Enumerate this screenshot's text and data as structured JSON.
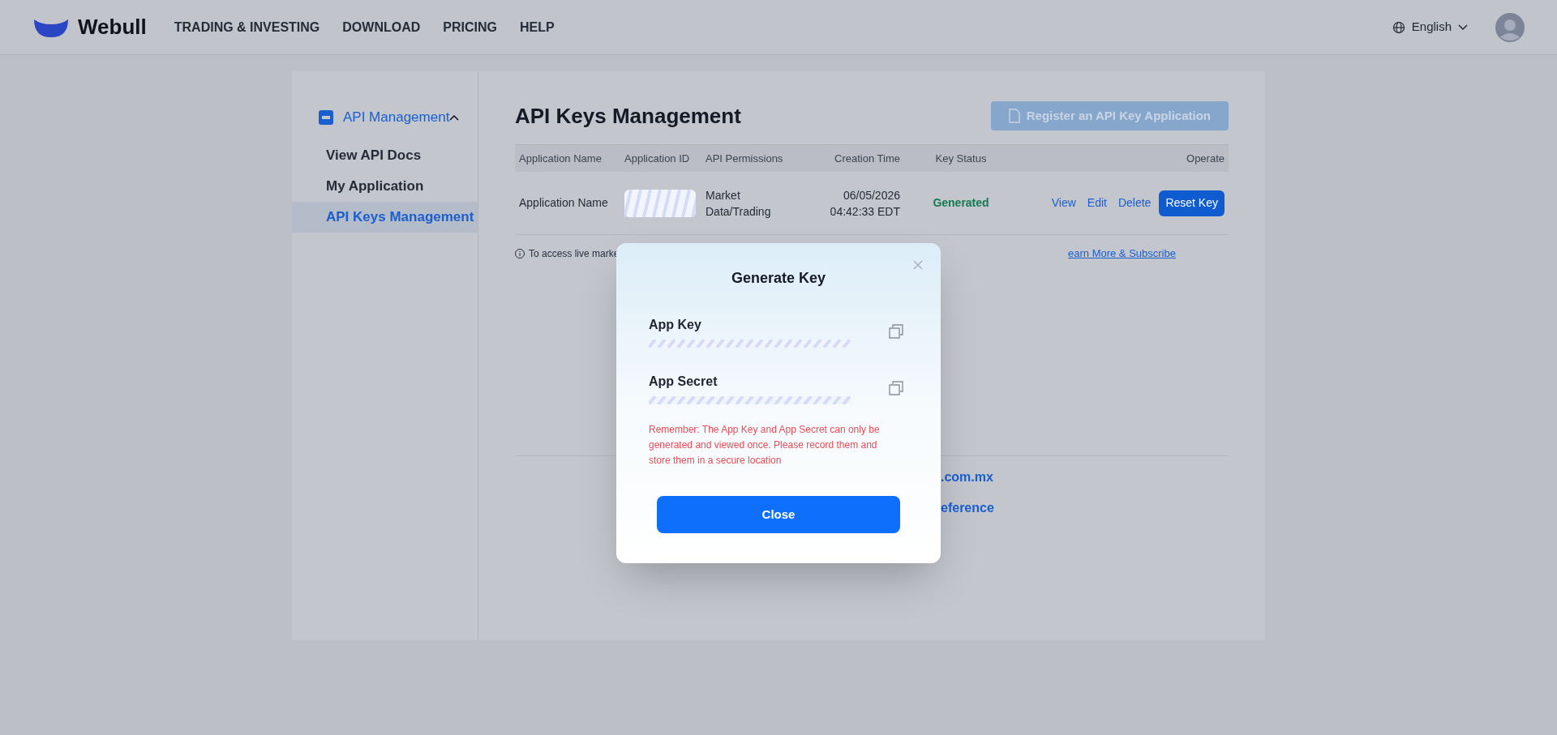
{
  "header": {
    "logo_text": "Webull",
    "nav": [
      "TRADING & INVESTING",
      "DOWNLOAD",
      "PRICING",
      "HELP"
    ],
    "language": "English"
  },
  "sidebar": {
    "group": {
      "label": "API Management",
      "expanded": true
    },
    "items": [
      {
        "label": "View API Docs",
        "selected": false
      },
      {
        "label": "My Application",
        "selected": false
      },
      {
        "label": "API Keys Management",
        "selected": true
      }
    ]
  },
  "main": {
    "title": "API Keys Management",
    "register_button": {
      "label": "Register an API Key Application",
      "disabled": true
    },
    "table": {
      "columns": [
        "Application Name",
        "Application ID",
        "API Permissions",
        "Creation Time",
        "Key Status",
        "Operate"
      ],
      "rows": [
        {
          "application_name": "Application Name",
          "application_id_redacted": true,
          "permissions": "Market Data/Trading",
          "creation_time": "06/05/2026 04:42:33 EDT",
          "key_status": {
            "text": "Generated",
            "kind": "generated"
          },
          "actions": [
            "View",
            "Edit",
            "Delete"
          ],
          "primary_action": "Reset Key"
        }
      ]
    },
    "notice": {
      "text": "To access live marke",
      "link": "earn More & Subscribe"
    },
    "footer_links": [
      ".com.mx",
      "eference"
    ]
  },
  "modal": {
    "title": "Generate Key",
    "fields": [
      {
        "label": "App Key",
        "redacted": true
      },
      {
        "label": "App Secret",
        "redacted": true
      }
    ],
    "warning": "Remember: The App Key and App Secret can only be generated and viewed once. Please record them and store them in a secure location",
    "button": "Close"
  }
}
